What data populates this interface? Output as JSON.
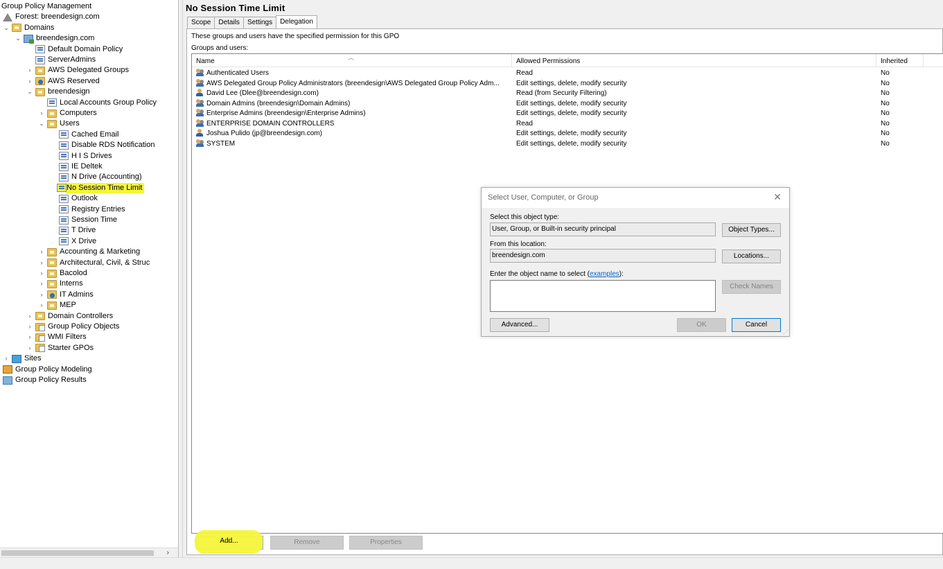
{
  "tree": {
    "items": [
      {
        "label": "Group Policy Management",
        "icon": "gpm-root-icon",
        "chevron": ""
      },
      {
        "label": "Forest: breendesign.com",
        "icon": "forest-icon",
        "chevron": ""
      },
      {
        "label": "Domains",
        "icon": "domains-folder-icon",
        "chevron": "expanded"
      },
      {
        "label": "breendesign.com",
        "icon": "domain-icon",
        "chevron": "expanded"
      },
      {
        "label": "Default Domain Policy",
        "icon": "gpo-link-icon",
        "chevron": ""
      },
      {
        "label": "ServerAdmins",
        "icon": "gpo-link-icon",
        "chevron": ""
      },
      {
        "label": "AWS Delegated Groups",
        "icon": "ou-folder-icon",
        "chevron": "collapsed"
      },
      {
        "label": "AWS Reserved",
        "icon": "ou-info-icon",
        "chevron": "collapsed"
      },
      {
        "label": "breendesign",
        "icon": "ou-folder-icon",
        "chevron": "expanded"
      },
      {
        "label": "Local Accounts Group Policy",
        "icon": "gpo-link-icon",
        "chevron": ""
      },
      {
        "label": "Computers",
        "icon": "ou-folder-icon",
        "chevron": "collapsed"
      },
      {
        "label": "Users",
        "icon": "ou-folder-icon",
        "chevron": "expanded"
      },
      {
        "label": "Cached Email",
        "icon": "gpo-link-icon",
        "chevron": ""
      },
      {
        "label": "Disable RDS Notification",
        "icon": "gpo-link-icon",
        "chevron": ""
      },
      {
        "label": "H I S Drives",
        "icon": "gpo-link-icon",
        "chevron": ""
      },
      {
        "label": "IE Deltek",
        "icon": "gpo-link-icon",
        "chevron": ""
      },
      {
        "label": "N Drive (Accounting)",
        "icon": "gpo-link-icon",
        "chevron": ""
      },
      {
        "label": "No Session Time Limit",
        "icon": "gpo-link-icon",
        "chevron": "",
        "highlighted": true
      },
      {
        "label": "Outlook",
        "icon": "gpo-link-icon",
        "chevron": ""
      },
      {
        "label": "Registry Entries",
        "icon": "gpo-link-icon",
        "chevron": ""
      },
      {
        "label": "Session Time",
        "icon": "gpo-link-icon",
        "chevron": ""
      },
      {
        "label": "T Drive",
        "icon": "gpo-link-icon",
        "chevron": ""
      },
      {
        "label": "X Drive",
        "icon": "gpo-link-icon",
        "chevron": ""
      },
      {
        "label": "Accounting & Marketing",
        "icon": "ou-folder-icon",
        "chevron": "collapsed"
      },
      {
        "label": "Architectural, Civil, & Struc",
        "icon": "ou-folder-icon",
        "chevron": "collapsed"
      },
      {
        "label": "Bacolod",
        "icon": "ou-folder-icon",
        "chevron": "collapsed"
      },
      {
        "label": "Interns",
        "icon": "ou-folder-icon",
        "chevron": "collapsed"
      },
      {
        "label": "IT Admins",
        "icon": "ou-info-icon",
        "chevron": "collapsed"
      },
      {
        "label": "MEP",
        "icon": "ou-folder-icon",
        "chevron": "collapsed"
      },
      {
        "label": "Domain Controllers",
        "icon": "ou-folder-icon",
        "chevron": "collapsed"
      },
      {
        "label": "Group Policy Objects",
        "icon": "gpo-folder-icon",
        "chevron": "collapsed"
      },
      {
        "label": "WMI Filters",
        "icon": "wmi-folder-icon",
        "chevron": "collapsed"
      },
      {
        "label": "Starter GPOs",
        "icon": "starter-folder-icon",
        "chevron": "collapsed"
      },
      {
        "label": "Sites",
        "icon": "sites-icon",
        "chevron": "collapsed"
      },
      {
        "label": "Group Policy Modeling",
        "icon": "modeling-icon",
        "chevron": ""
      },
      {
        "label": "Group Policy Results",
        "icon": "results-icon",
        "chevron": ""
      }
    ]
  },
  "main": {
    "title": "No Session Time Limit",
    "tabs": [
      {
        "label": "Scope",
        "active": false
      },
      {
        "label": "Details",
        "active": false
      },
      {
        "label": "Settings",
        "active": false
      },
      {
        "label": "Delegation",
        "active": true
      }
    ],
    "description": "These groups and users have the specified permission for this GPO",
    "groups_label": "Groups and users:",
    "columns": {
      "name": "Name",
      "permissions": "Allowed Permissions",
      "inherited": "Inherited"
    },
    "rows": [
      {
        "icon": "group",
        "name": "Authenticated Users",
        "permissions": "Read",
        "inherited": "No"
      },
      {
        "icon": "group",
        "name": "AWS Delegated Group Policy Administrators (breendesign\\AWS Delegated Group Policy Adm...",
        "permissions": "Edit settings, delete, modify security",
        "inherited": "No"
      },
      {
        "icon": "user",
        "name": "David Lee (Dlee@breendesign.com)",
        "permissions": "Read (from Security Filtering)",
        "inherited": "No"
      },
      {
        "icon": "group",
        "name": "Domain Admins (breendesign\\Domain Admins)",
        "permissions": "Edit settings, delete, modify security",
        "inherited": "No"
      },
      {
        "icon": "group",
        "name": "Enterprise Admins (breendesign\\Enterprise Admins)",
        "permissions": "Edit settings, delete, modify security",
        "inherited": "No"
      },
      {
        "icon": "group",
        "name": "ENTERPRISE DOMAIN CONTROLLERS",
        "permissions": "Read",
        "inherited": "No"
      },
      {
        "icon": "user",
        "name": "Joshua Pulido (jp@breendesign.com)",
        "permissions": "Edit settings, delete, modify security",
        "inherited": "No"
      },
      {
        "icon": "group",
        "name": "SYSTEM",
        "permissions": "Edit settings, delete, modify security",
        "inherited": "No"
      }
    ],
    "buttons": {
      "add": "Add...",
      "remove": "Remove",
      "properties": "Properties"
    }
  },
  "dialog": {
    "title": "Select User, Computer, or Group",
    "close": "✕",
    "object_type_label": "Select this object type:",
    "object_type_value": "User, Group, or Built-in security principal",
    "object_types_button": "Object Types...",
    "location_label": "From this location:",
    "location_value": "breendesign.com",
    "locations_button": "Locations...",
    "enter_label_prefix": "Enter the object name to select (",
    "enter_label_link": "examples",
    "enter_label_suffix": "):",
    "object_name_value": "",
    "check_names_button": "Check Names",
    "advanced_button": "Advanced...",
    "ok_button": "OK",
    "cancel_button": "Cancel"
  },
  "colors": {
    "highlight": "#f5f53a",
    "link": "#0066cc"
  }
}
